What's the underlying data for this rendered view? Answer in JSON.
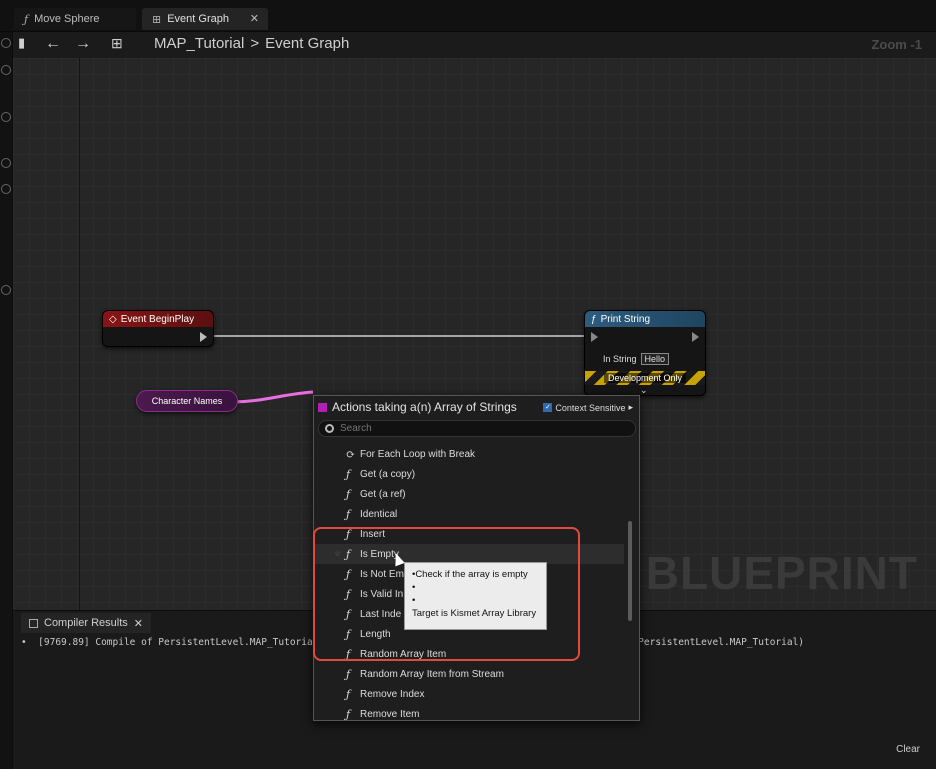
{
  "tabs": [
    {
      "label": "Move Sphere",
      "icon": "function-icon"
    },
    {
      "label": "Event Graph",
      "icon": "graph-icon"
    }
  ],
  "breadcrumb": {
    "blueprint": "MAP_Tutorial",
    "separator": ">",
    "graph": "Event Graph"
  },
  "zoom": "Zoom -1",
  "watermark": "EL BLUEPRINT",
  "nodes": {
    "begin_play": "Event BeginPlay",
    "print_string": "Print String",
    "in_string_label": "In String",
    "in_string_value": "Hello",
    "dev_only": "Development Only",
    "character_names": "Character Names"
  },
  "menu": {
    "title": "Actions taking a(n) Array of Strings",
    "context_sensitive": "Context Sensitive",
    "search_placeholder": "Search",
    "items": [
      "For Each Loop with Break",
      "Get (a copy)",
      "Get (a ref)",
      "Identical",
      "Insert",
      "Is Empty",
      "Is Not Em",
      "Is Valid In",
      "Last Inde",
      "Length",
      "Random Array Item",
      "Random Array Item from Stream",
      "Remove Index",
      "Remove Item"
    ]
  },
  "tooltip": {
    "line1": "•Check if the array is empty",
    "line2": "•",
    "line3": "•",
    "line4": "Target is Kismet Array Library"
  },
  "compiler": {
    "tab": "Compiler Results",
    "log_left": "•  [9769.89] Compile of PersistentLevel.MAP_Tutorial",
    "log_right": "al:PersistentLevel.MAP_Tutorial)",
    "clear": "Clear"
  },
  "colors": {
    "highlight": "#e04b3c",
    "array_pin": "#e86fe0",
    "exec_wire": "#cfcfcf"
  }
}
